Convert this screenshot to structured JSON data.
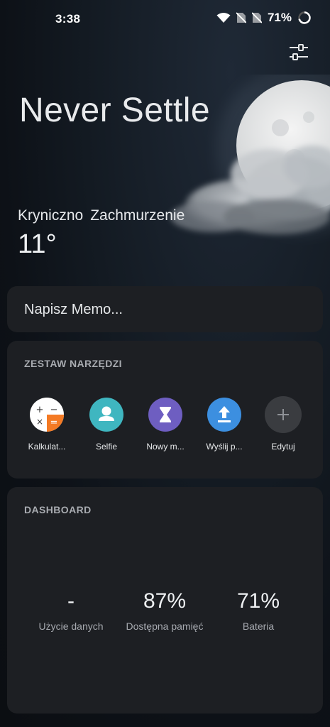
{
  "status_bar": {
    "time": "3:38",
    "battery_percent": "71%",
    "battery_level": 0.71,
    "icons": [
      "wifi-icon",
      "no-sim-icon",
      "no-sim-icon",
      "battery-ring-icon"
    ]
  },
  "header": {
    "settings_icon": "sliders-icon",
    "title": "Never Settle"
  },
  "weather": {
    "location": "Kryniczno",
    "condition": "Zachmurzenie",
    "temperature": "11°",
    "illustration": "moon-behind-cloud"
  },
  "memo": {
    "placeholder": "Napisz Memo..."
  },
  "toolbox": {
    "title": "ZESTAW NARZĘDZI",
    "items": [
      {
        "label": "Kalkulat...",
        "icon": "calculator-icon",
        "color": "#ffffff"
      },
      {
        "label": "Selfie",
        "icon": "person-icon",
        "color": "#3fb6c0"
      },
      {
        "label": "Nowy m...",
        "icon": "hourglass-icon",
        "color": "#6e5ec1"
      },
      {
        "label": "Wyślij p...",
        "icon": "upload-icon",
        "color": "#3c8fe0"
      },
      {
        "label": "Edytuj",
        "icon": "plus-icon",
        "color": "#3a3c40"
      }
    ]
  },
  "dashboard": {
    "title": "DASHBOARD",
    "stats": [
      {
        "value": "-",
        "label": "Użycie danych"
      },
      {
        "value": "87%",
        "label": "Dostępna pamięć"
      },
      {
        "value": "71%",
        "label": "Bateria"
      }
    ]
  }
}
